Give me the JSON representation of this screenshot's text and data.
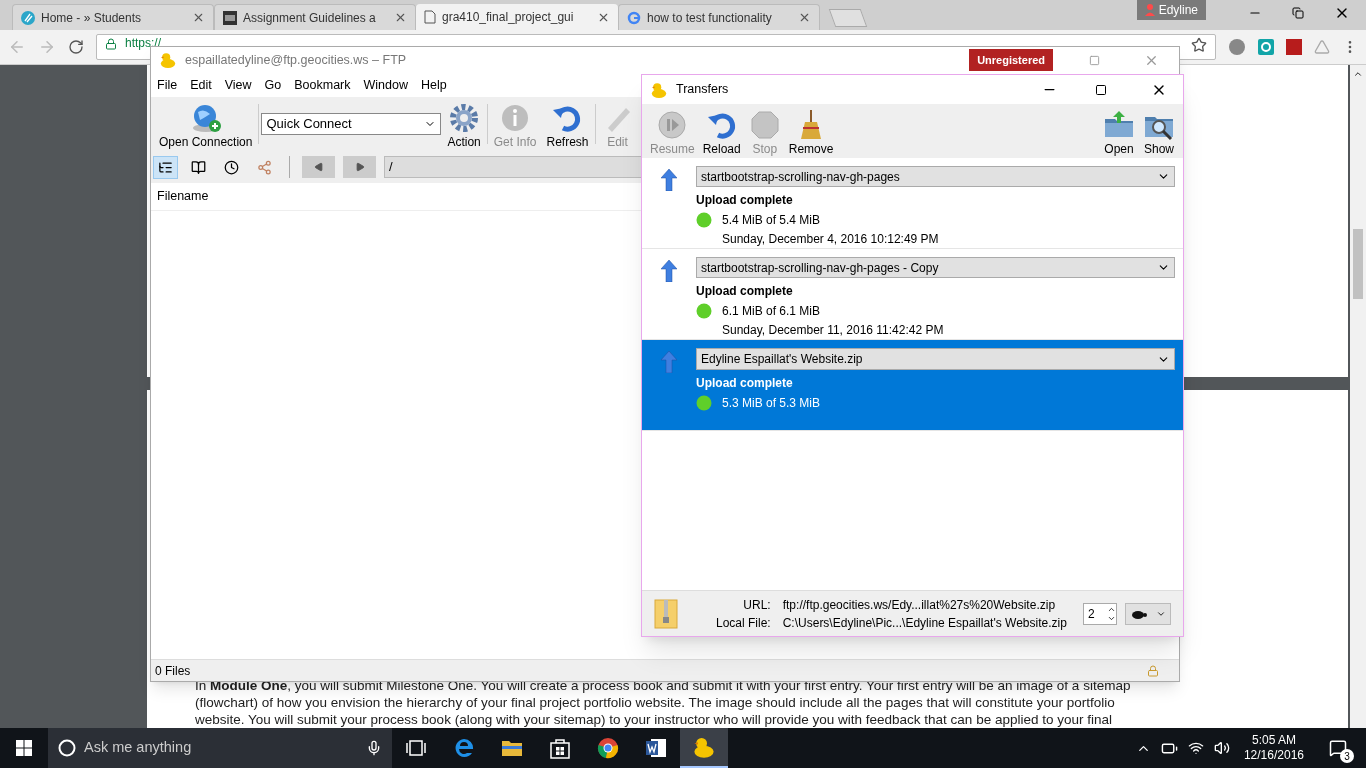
{
  "browser": {
    "tabs": [
      {
        "title": "Home - » Students",
        "selected": false
      },
      {
        "title": "Assignment Guidelines a",
        "selected": false
      },
      {
        "title": "gra410_final_project_gui",
        "selected": true
      },
      {
        "title": "how to test functionality",
        "selected": false
      }
    ],
    "profile": "Edyline",
    "url": "https://",
    "paragraph": "In **Module One**, you will submit Milestone One. You will create a process book and submit it with your first entry. Your first entry will be an image of a sitemap (flowchart) of how you envision the hierarchy of your final project portfolio website. The image should include all the pages that will constitute your portfolio website. You will submit your process book (along with your sitemap) to your instructor who will provide you with feedback that can be applied to your final"
  },
  "ftp_window": {
    "title": "espaillatedyline@ftp.geocities.ws – FTP",
    "badge": "Unregistered",
    "menu": [
      "File",
      "Edit",
      "View",
      "Go",
      "Bookmark",
      "Window",
      "Help"
    ],
    "toolbar": [
      {
        "kind": "open",
        "label": "Open Connection",
        "disabled": false
      },
      {
        "kind": "action",
        "label": "Action",
        "disabled": false
      },
      {
        "kind": "info",
        "label": "Get Info",
        "disabled": true
      },
      {
        "kind": "refresh",
        "label": "Refresh",
        "disabled": false
      },
      {
        "kind": "edit",
        "label": "Edit",
        "disabled": true
      }
    ],
    "quick_connect": "Quick Connect",
    "view_buttons": [
      {
        "kind": "browser",
        "selected": true
      },
      {
        "kind": "bookmarks",
        "selected": false
      },
      {
        "kind": "history",
        "selected": false
      },
      {
        "kind": "bonjour",
        "selected": false
      }
    ],
    "path": "/",
    "column": "Filename",
    "status": "0 Files"
  },
  "transfers_window": {
    "title": "Transfers",
    "toolbar": [
      {
        "kind": "resume",
        "label": "Resume",
        "disabled": true
      },
      {
        "kind": "reload",
        "label": "Reload",
        "disabled": false
      },
      {
        "kind": "stop",
        "label": "Stop",
        "disabled": true
      },
      {
        "kind": "remove",
        "label": "Remove",
        "disabled": false
      },
      {
        "kind": "open",
        "label": "Open",
        "disabled": false
      },
      {
        "kind": "show",
        "label": "Show",
        "disabled": false
      }
    ],
    "transfers": [
      {
        "name": "startbootstrap-scrolling-nav-gh-pages",
        "status": "Upload complete",
        "size": "5.4 MiB of 5.4 MiB",
        "date": "Sunday, December 4, 2016 10:12:49 PM",
        "selected": false
      },
      {
        "name": "startbootstrap-scrolling-nav-gh-pages - Copy",
        "status": "Upload complete",
        "size": "6.1 MiB of 6.1 MiB",
        "date": "Sunday, December 11, 2016 11:42:42 PM",
        "selected": false
      },
      {
        "name": "Edyline Espaillat's Website.zip",
        "status": "Upload complete",
        "size": "5.3 MiB of 5.3 MiB",
        "selected": true
      }
    ],
    "url_label": "URL:",
    "url": "ftp://ftp.geocities.ws/Edy...illat%27s%20Website.zip",
    "local_label": "Local File:",
    "local_file": "C:\\Users\\Edyline\\Pic...\\Edyline Espaillat's Website.zip",
    "connections": "2"
  },
  "taskbar": {
    "search_placeholder": "Ask me anything",
    "apps": [
      {
        "kind": "taskview",
        "active": false
      },
      {
        "kind": "edge",
        "active": false
      },
      {
        "kind": "explorer",
        "active": false
      },
      {
        "kind": "store",
        "active": false
      },
      {
        "kind": "chrome",
        "active": false
      },
      {
        "kind": "word",
        "active": false
      },
      {
        "kind": "duck",
        "active": true
      }
    ],
    "time": "5:05 AM",
    "date": "12/16/2016",
    "notifications": "3"
  }
}
